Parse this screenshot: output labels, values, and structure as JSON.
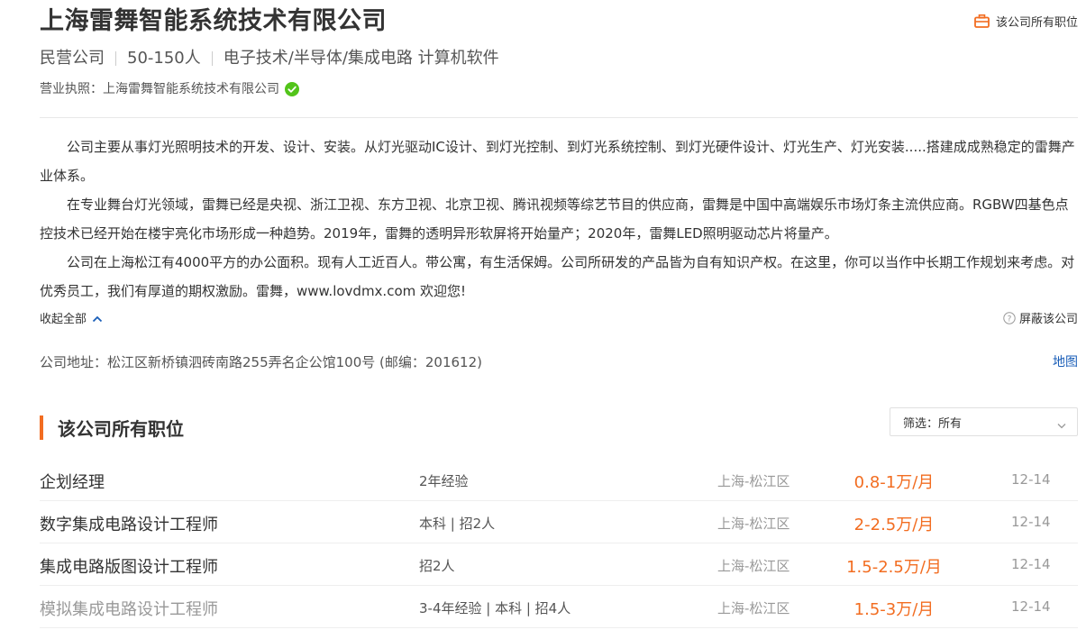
{
  "company": {
    "name": "上海雷舞智能系统技术有限公司",
    "all_jobs_link": "该公司所有职位",
    "meta": [
      "民营公司",
      "50-150人",
      "电子技术/半导体/集成电路 计算机软件"
    ],
    "license_label": "营业执照：上海雷舞智能系统技术有限公司"
  },
  "description": {
    "paragraphs": [
      "公司主要从事灯光照明技术的开发、设计、安装。从灯光驱动IC设计、到灯光控制、到灯光系统控制、到灯光硬件设计、灯光生产、灯光安装.....搭建成成熟稳定的雷舞产业体系。",
      "在专业舞台灯光领域，雷舞已经是央视、浙江卫视、东方卫视、北京卫视、腾讯视频等综艺节目的供应商，雷舞是中国中高端娱乐市场灯条主流供应商。RGBW四基色点控技术已经开始在楼宇亮化市场形成一种趋势。2019年，雷舞的透明异形软屏将开始量产；2020年，雷舞LED照明驱动芯片将量产。",
      "公司在上海松江有4000平方的办公面积。现有人工近百人。带公寓，有生活保姆。公司所研发的产品皆为自有知识产权。在这里，你可以当作中长期工作规划来考虑。对优秀员工，我们有厚道的期权激励。雷舞，www.lovdmx.com 欢迎您!"
    ],
    "collapse_label": "收起全部",
    "block_label": "屏蔽该公司"
  },
  "address": {
    "text": "公司地址：松江区新桥镇泗砖南路255弄名企公馆100号 (邮编：201612)",
    "map_label": "地图"
  },
  "jobs_section": {
    "title": "该公司所有职位",
    "filter_label": "筛选：所有",
    "rows": [
      {
        "title": "企划经理",
        "requirements": "2年经验",
        "location": "上海-松江区",
        "salary": "0.8-1万/月",
        "date": "12-14"
      },
      {
        "title": "数字集成电路设计工程师",
        "requirements": "本科 | 招2人",
        "location": "上海-松江区",
        "salary": "2-2.5万/月",
        "date": "12-14"
      },
      {
        "title": "集成电路版图设计工程师",
        "requirements": "招2人",
        "location": "上海-松江区",
        "salary": "1.5-2.5万/月",
        "date": "12-14"
      },
      {
        "title": "模拟集成电路设计工程师",
        "requirements": "3-4年经验 | 本科 | 招4人",
        "location": "上海-松江区",
        "salary": "1.5-3万/月",
        "date": "12-14"
      }
    ]
  },
  "colors": {
    "accent": "#f26d21",
    "link": "#1a5eb8",
    "verified": "#52c41a"
  },
  "icons": {
    "jobs_link": "briefcase-icon",
    "verified": "check-circle-icon",
    "collapse": "chevron-up-icon",
    "block": "question-circle-icon",
    "filter": "chevron-down-icon"
  }
}
